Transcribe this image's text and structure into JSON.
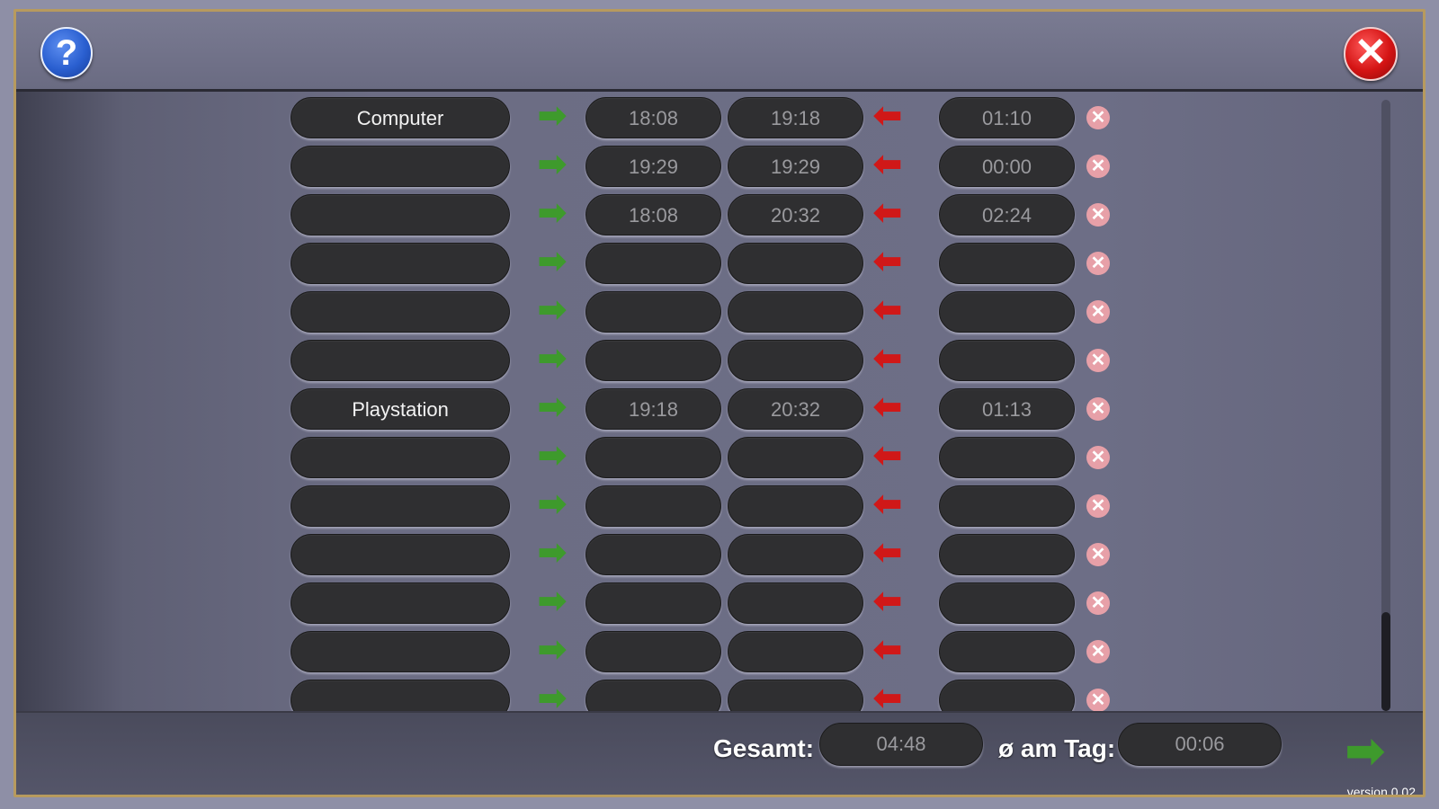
{
  "header": {
    "help_icon": "question-mark",
    "help_label": "?",
    "close_icon": "close-x",
    "close_label": "✕"
  },
  "rows": [
    {
      "name": "Computer",
      "start": "18:08",
      "end": "19:18",
      "duration": "01:10"
    },
    {
      "name": "",
      "start": "19:29",
      "end": "19:29",
      "duration": "00:00"
    },
    {
      "name": "",
      "start": "18:08",
      "end": "20:32",
      "duration": "02:24"
    },
    {
      "name": "",
      "start": "",
      "end": "",
      "duration": ""
    },
    {
      "name": "",
      "start": "",
      "end": "",
      "duration": ""
    },
    {
      "name": "",
      "start": "",
      "end": "",
      "duration": ""
    },
    {
      "name": "Playstation",
      "start": "19:18",
      "end": "20:32",
      "duration": "01:13"
    },
    {
      "name": "",
      "start": "",
      "end": "",
      "duration": ""
    },
    {
      "name": "",
      "start": "",
      "end": "",
      "duration": ""
    },
    {
      "name": "",
      "start": "",
      "end": "",
      "duration": ""
    },
    {
      "name": "",
      "start": "",
      "end": "",
      "duration": ""
    },
    {
      "name": "",
      "start": "",
      "end": "",
      "duration": ""
    },
    {
      "name": "",
      "start": "",
      "end": "",
      "duration": ""
    }
  ],
  "row_icons": {
    "start_arrow": "green-right-arrow",
    "end_arrow": "red-left-arrow",
    "delete": "delete-x"
  },
  "footer": {
    "total_label": "Gesamt:",
    "total_value": "04:48",
    "avg_label": "ø am Tag:",
    "avg_value": "00:06",
    "next_icon": "green-right-arrow",
    "version": "version 0.02"
  },
  "colors": {
    "accent_green": "#3e9a2c",
    "accent_red": "#d01818",
    "pill_bg": "#2f2f31",
    "frame_border": "#b79a5e"
  }
}
